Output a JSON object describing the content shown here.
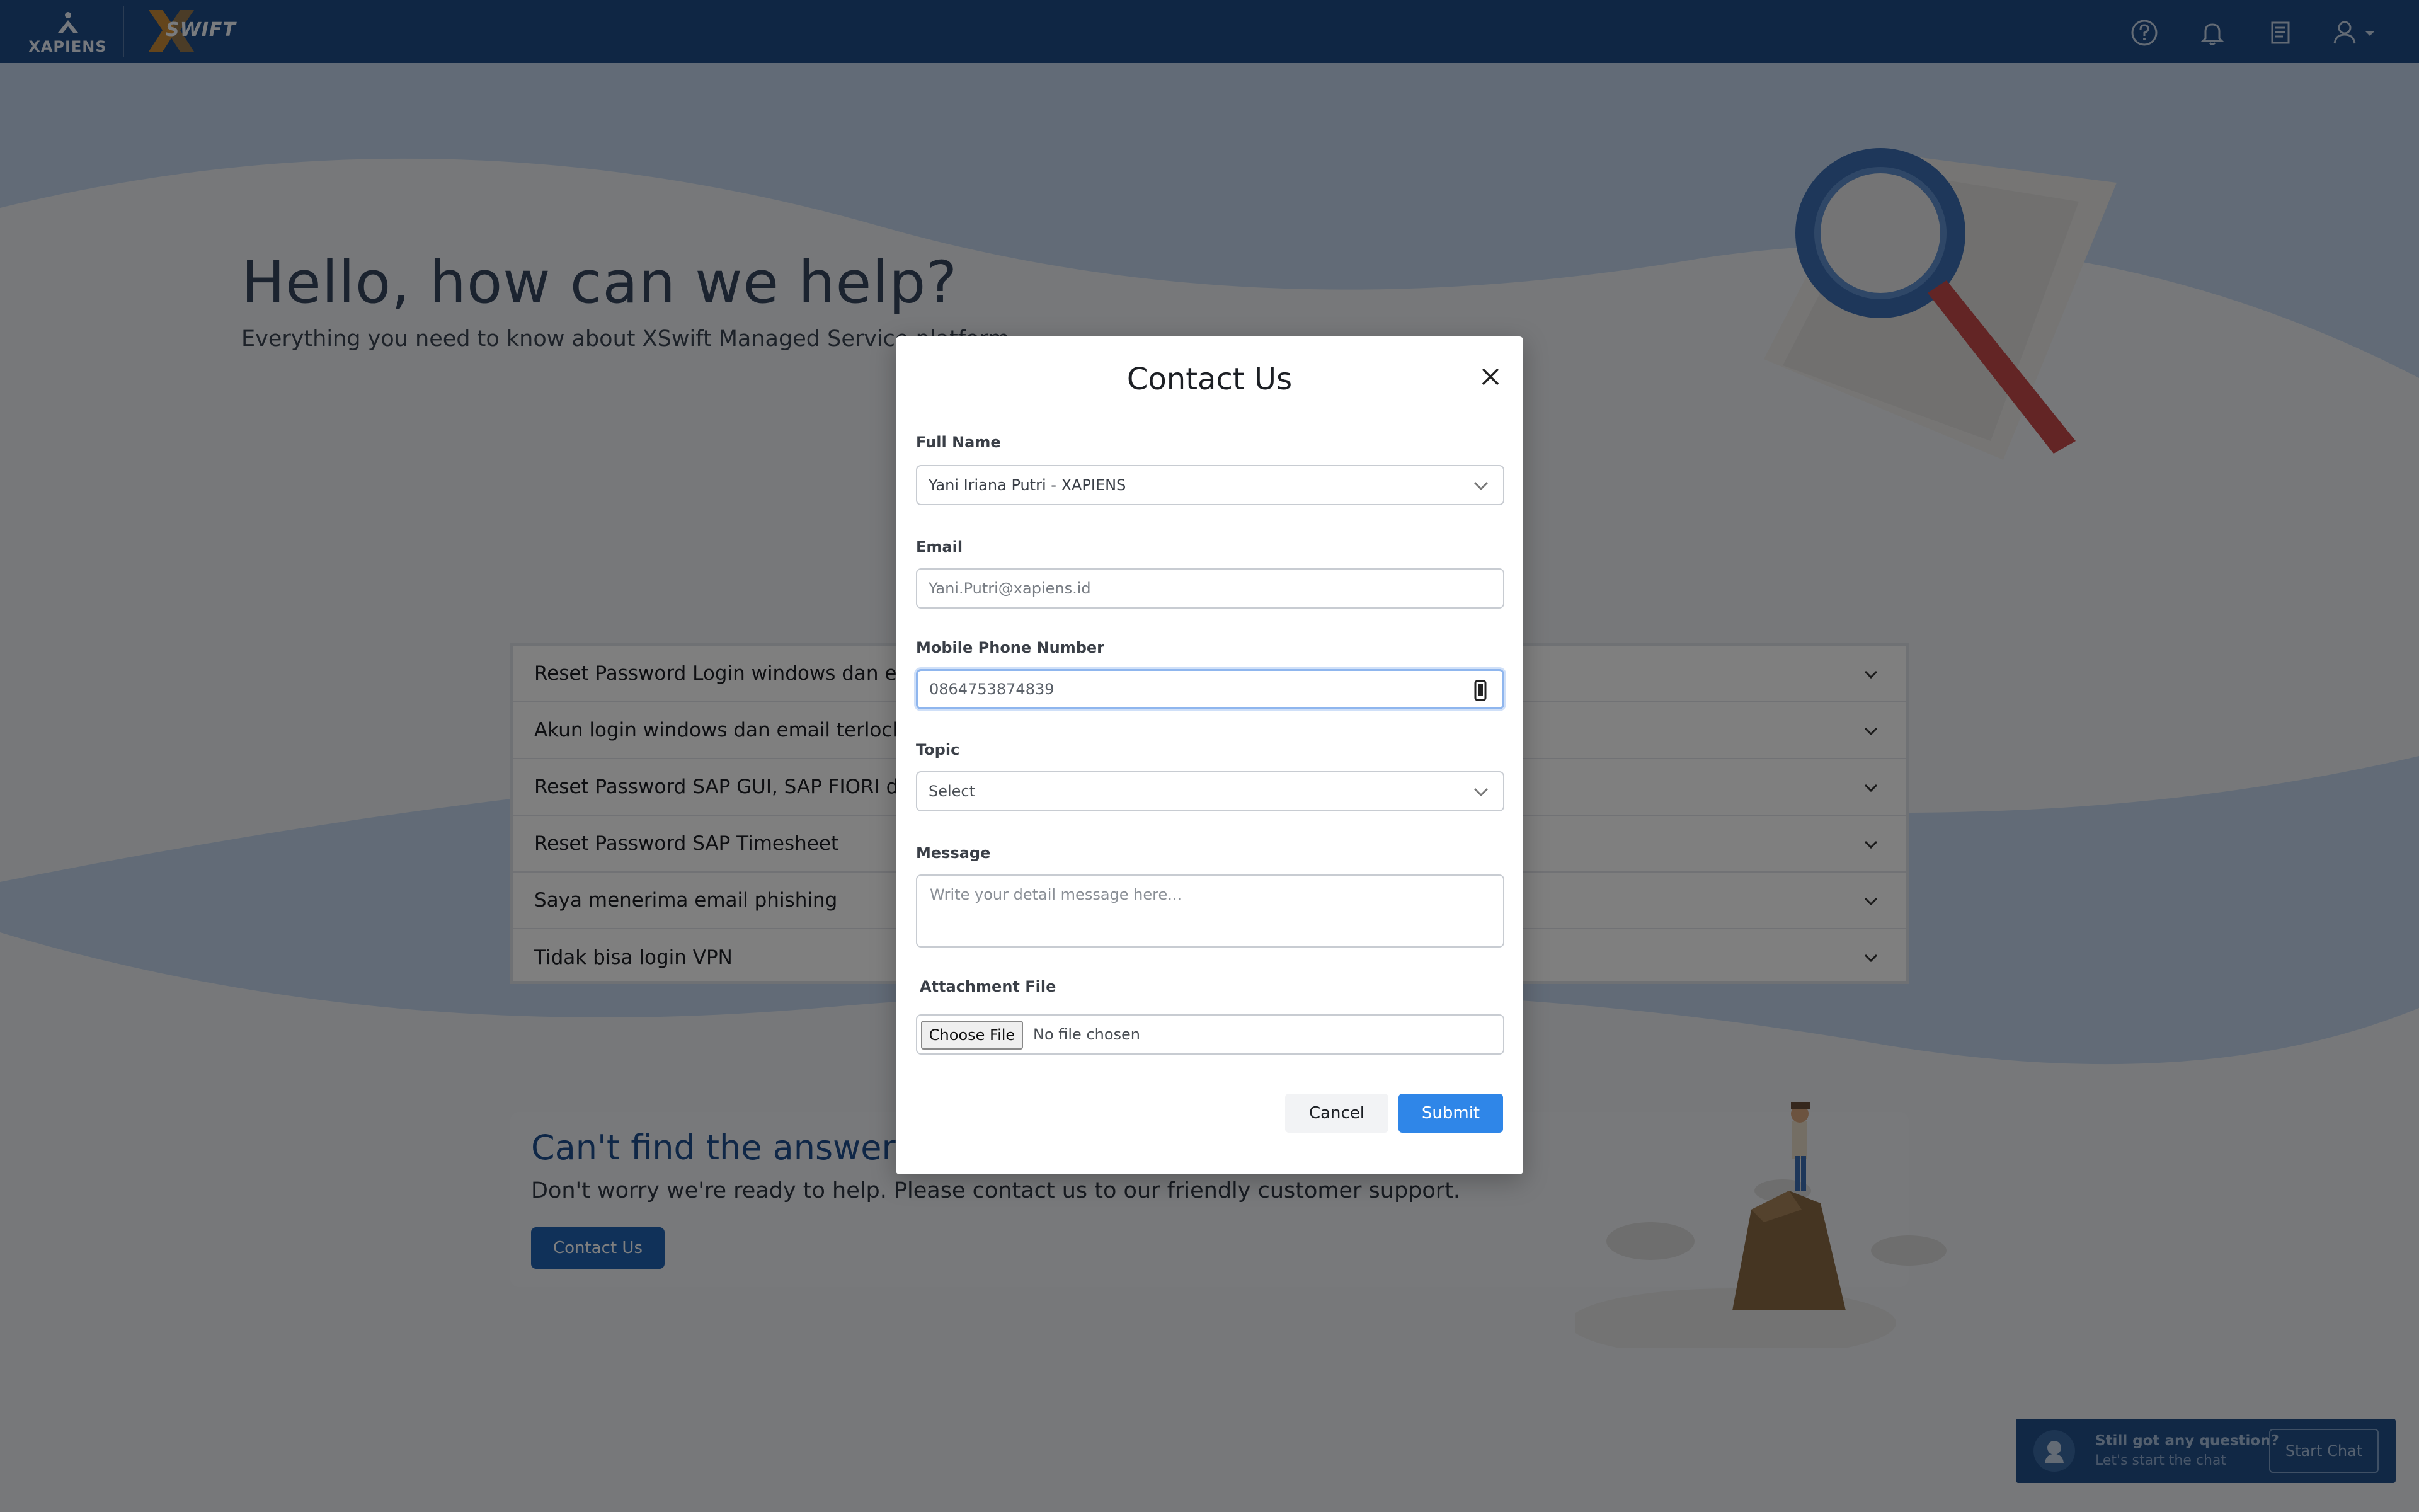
{
  "header": {
    "logo_xapiens": "XAPIENS",
    "logo_xswift": "SWIFT",
    "icons": [
      "help-icon",
      "bell-icon",
      "document-icon",
      "user-icon"
    ]
  },
  "hero": {
    "title": "Hello, how can we help?",
    "subtitle": "Everything you need to know about XSwift Managed Service platform"
  },
  "faq": {
    "items": [
      {
        "question": "Reset Password Login windows dan email"
      },
      {
        "question": "Akun login windows dan email terlock"
      },
      {
        "question": "Reset Password SAP GUI, SAP FIORI dan SAP"
      },
      {
        "question": "Reset Password SAP Timesheet"
      },
      {
        "question": "Saya menerima email phishing"
      },
      {
        "question": "Tidak bisa login VPN"
      }
    ]
  },
  "contact_band": {
    "title": "Can't find the answer you",
    "subtitle": "Don't worry we're ready to help. Please contact us to our friendly customer support.",
    "button": "Contact Us"
  },
  "chat": {
    "title": "Still got any question?",
    "subtitle": "Let's start the chat",
    "button": "Start Chat"
  },
  "modal": {
    "title": "Contact Us",
    "full_name": {
      "label": "Full Name",
      "value": "Yani Iriana Putri - XAPIENS"
    },
    "email": {
      "label": "Email",
      "value": "Yani.Putri@xapiens.id"
    },
    "phone": {
      "label": "Mobile Phone Number",
      "value": "0864753874839"
    },
    "topic": {
      "label": "Topic",
      "value": "Select"
    },
    "message": {
      "label": "Message",
      "placeholder": "Write your detail message here..."
    },
    "attachment": {
      "label": "Attachment File",
      "button": "Choose File",
      "status": "No file chosen"
    },
    "cancel": "Cancel",
    "submit": "Submit"
  },
  "colors": {
    "header": "#1f4d88",
    "primary_button": "#2f86e8",
    "band_button": "#2162b3",
    "chat_widget": "#23518a"
  }
}
